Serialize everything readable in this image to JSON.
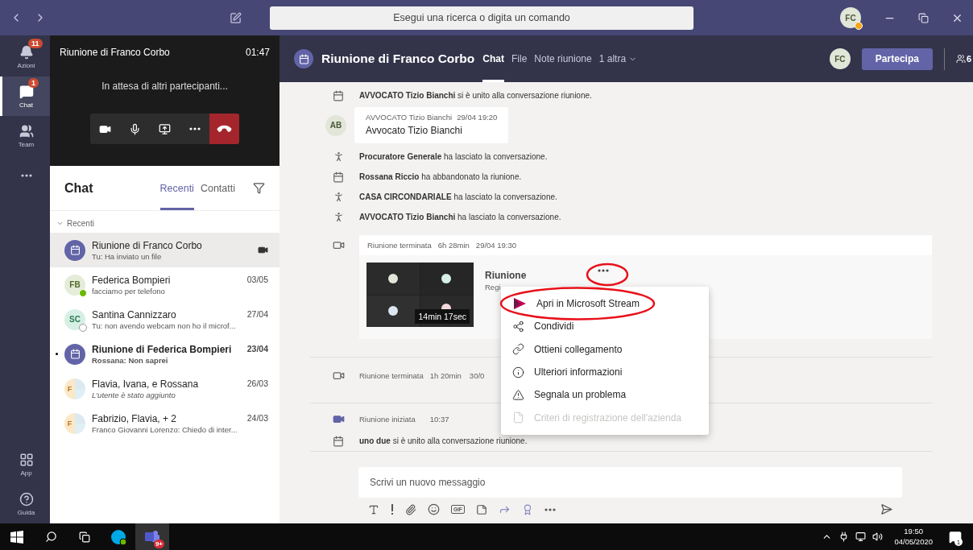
{
  "title_bar": {
    "search_placeholder": "Esegui una ricerca o digita un comando",
    "avatar": "FC"
  },
  "rail": {
    "items": [
      {
        "kind": "bell",
        "label": "Azioni",
        "badge": "11",
        "selected": false
      },
      {
        "kind": "chat",
        "label": "Chat",
        "badge": "1",
        "selected": true
      },
      {
        "kind": "team",
        "label": "Team",
        "selected": false
      },
      {
        "kind": "more",
        "selected": false
      }
    ],
    "bottom": [
      {
        "kind": "apps",
        "label": "App"
      },
      {
        "kind": "help",
        "label": "Guida"
      }
    ]
  },
  "call": {
    "title": "Riunione di Franco Corbo",
    "time": "01:47",
    "status": "In attesa di altri partecipanti..."
  },
  "chat_list": {
    "title": "Chat",
    "tabs": [
      {
        "label": "Recenti",
        "selected": true
      },
      {
        "label": "Contatti",
        "selected": false
      }
    ],
    "section": "Recenti",
    "items": [
      {
        "avatar": {
          "kind": "meeting"
        },
        "title": "Riunione di Franco Corbo",
        "preview": "Tu: Ha inviato un file",
        "selected": true,
        "unread": false,
        "system_preview": false,
        "in_call": true
      },
      {
        "avatar": {
          "kind": "initials",
          "initials": "FB",
          "available": true
        },
        "title": "Federica Bompieri",
        "date": "03/05",
        "preview": "facciamo per telefono",
        "selected": false,
        "unread": false,
        "system_preview": false,
        "in_call": false
      },
      {
        "avatar": {
          "kind": "initials",
          "initials": "SC",
          "available": false
        },
        "title": "Santina Cannizzaro",
        "date": "27/04",
        "preview": "Tu: non avendo webcam non ho il microf...",
        "selected": false,
        "unread": false,
        "system_preview": false,
        "in_call": false
      },
      {
        "avatar": {
          "kind": "meeting"
        },
        "title": "Riunione di Federica Bompieri",
        "date": "23/04",
        "preview": "Rossana: Non saprei",
        "selected": false,
        "unread": true,
        "system_preview": false,
        "in_call": false
      },
      {
        "avatar": {
          "kind": "group",
          "initial": "F"
        },
        "title": "Flavia, Ivana, e Rossana",
        "date": "26/03",
        "preview": "L'utente è stato aggiunto",
        "selected": false,
        "unread": false,
        "system_preview": true,
        "in_call": false
      },
      {
        "avatar": {
          "kind": "group",
          "initial": "F"
        },
        "title": "Fabrizio, Flavia, + 2",
        "date": "24/03",
        "preview": "Franco Giovanni Lorenzo: Chiedo di inter...",
        "selected": false,
        "unread": false,
        "system_preview": false,
        "in_call": false
      }
    ]
  },
  "header": {
    "title": "Riunione di Franco Corbo",
    "tabs": [
      {
        "label": "Chat",
        "selected": true,
        "dropdown": false
      },
      {
        "label": "File",
        "selected": false,
        "dropdown": false
      },
      {
        "label": "Note riunione",
        "selected": false,
        "dropdown": false
      },
      {
        "label": "1 altra",
        "selected": false,
        "dropdown": true
      }
    ],
    "avatar": "FC",
    "join_button": "Partecipa",
    "participants": "6"
  },
  "conversation": [
    {
      "kind": "join",
      "text": "**AVVOCATO Tizio Bianchi** si è unito alla conversazione riunione."
    },
    {
      "kind": "message",
      "avatar": "AB",
      "author": "AVVOCATO Tizio Bianchi",
      "time": "29/04 19:20",
      "text": "Avvocato Tizio Bianchi"
    },
    {
      "kind": "leave",
      "text": "**Procuratore Generale** ha lasciato la conversazione."
    },
    {
      "kind": "join",
      "text": "**Rossana Riccio** ha abbandonato la riunione."
    },
    {
      "kind": "leave",
      "text": "**CASA CIRCONDARIALE** ha lasciato la conversazione."
    },
    {
      "kind": "leave",
      "text": "**AVVOCATO Tizio Bianchi** ha lasciato la conversazione."
    },
    {
      "kind": "recording",
      "status": "Riunione terminata",
      "duration": "6h 28min",
      "when": "29/04 19:30",
      "title": "Riunione",
      "subtitle": "Regi",
      "length": "14min 17sec"
    },
    {
      "kind": "ended",
      "status": "Riunione terminata",
      "duration": "1h 20min",
      "when": "30/0"
    },
    {
      "kind": "started",
      "status": "Riunione iniziata",
      "when": "10:37"
    },
    {
      "kind": "join",
      "text": "**uno due** si è unito alla conversazione riunione."
    }
  ],
  "compose": {
    "placeholder": "Scrivi un nuovo messaggio",
    "gif": "GIF"
  },
  "context_menu": [
    {
      "kind": "stream",
      "label": "Apri in Microsoft Stream",
      "disabled": false
    },
    {
      "kind": "share",
      "label": "Condividi",
      "disabled": false
    },
    {
      "kind": "link",
      "label": "Ottieni collegamento",
      "disabled": false
    },
    {
      "kind": "info",
      "label": "Ulteriori informazioni",
      "disabled": false
    },
    {
      "kind": "warning",
      "label": "Segnala un problema",
      "disabled": false
    },
    {
      "kind": "file",
      "label": "Criteri di registrazione dell'azienda",
      "disabled": true
    }
  ],
  "taskbar": {
    "teams_badge": "9+",
    "time": "19:50",
    "date": "04/05/2020",
    "notifications": "1"
  }
}
